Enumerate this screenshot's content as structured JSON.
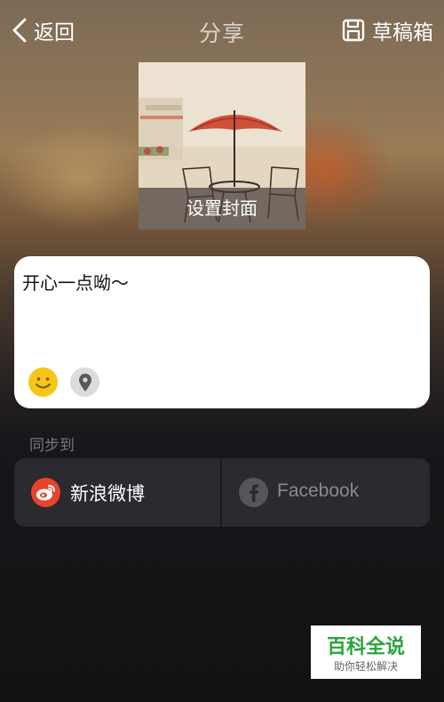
{
  "nav": {
    "back_label": "返回",
    "title": "分享",
    "draft_label": "草稿箱"
  },
  "cover": {
    "label": "设置封面"
  },
  "composer": {
    "text": "开心一点呦～"
  },
  "sync": {
    "label": "同步到",
    "weibo_label": "新浪微博",
    "facebook_label": "Facebook"
  },
  "watermark": {
    "title": "百科全说",
    "subtitle": "助你轻松解决"
  },
  "colors": {
    "weibo": "#e8432b",
    "emoji": "#f5c518",
    "watermark_green": "#2aa53a"
  }
}
